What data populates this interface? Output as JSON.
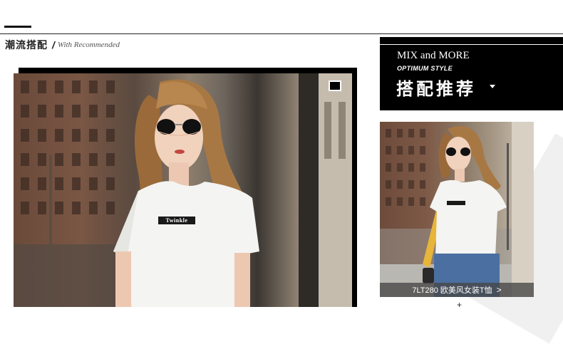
{
  "section": {
    "title_cn": "潮流搭配",
    "slash": "/",
    "title_en": "With Recommended"
  },
  "main_photo": {
    "shirt_text": "Twinkle"
  },
  "promo": {
    "title_en": "MIX and MORE",
    "subtitle": "OPTIMUM STYLE",
    "title_cn": "搭配推荐"
  },
  "product": {
    "caption": "7LT280 欧美风女装T恤",
    "chevron": ">",
    "more": "+"
  },
  "colors": {
    "black": "#000000",
    "white": "#ffffff",
    "caption_bg": "#464646"
  }
}
